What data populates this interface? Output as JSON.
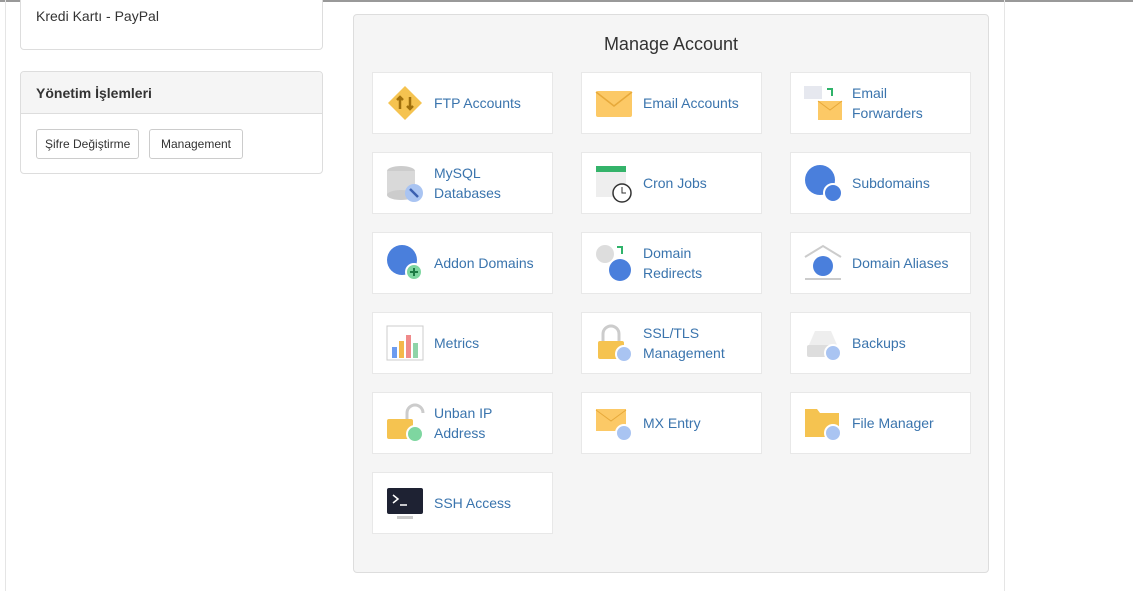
{
  "sidebar": {
    "payment_methods": "Kredi Kartı - PayPal",
    "management_panel": {
      "title": "Yönetim İşlemleri",
      "buttons": [
        "Şifre Değiştirme",
        "Management"
      ]
    }
  },
  "manage_account": {
    "title": "Manage Account",
    "tiles": [
      {
        "label": "FTP Accounts",
        "icon": "ftp-icon"
      },
      {
        "label": "Email Accounts",
        "icon": "envelope-icon"
      },
      {
        "label": "Email\nForwarders",
        "icon": "email-forward-icon"
      },
      {
        "label": "MySQL\nDatabases",
        "icon": "database-icon"
      },
      {
        "label": "Cron Jobs",
        "icon": "calendar-clock-icon"
      },
      {
        "label": "Subdomains",
        "icon": "globe-icon"
      },
      {
        "label": "Addon Domains",
        "icon": "globe-plus-icon"
      },
      {
        "label": "Domain\nRedirects",
        "icon": "globe-redirect-icon"
      },
      {
        "label": "Domain Aliases",
        "icon": "globe-house-icon"
      },
      {
        "label": "Metrics",
        "icon": "bar-chart-icon"
      },
      {
        "label": "SSL/TLS\nManagement",
        "icon": "lock-gear-icon"
      },
      {
        "label": "Backups",
        "icon": "drive-restore-icon"
      },
      {
        "label": "Unban IP\nAddress",
        "icon": "unlock-ip-icon"
      },
      {
        "label": "MX Entry",
        "icon": "envelope-gear-icon"
      },
      {
        "label": "File Manager",
        "icon": "folder-gear-icon"
      },
      {
        "label": "SSH Access",
        "icon": "terminal-icon"
      }
    ]
  }
}
